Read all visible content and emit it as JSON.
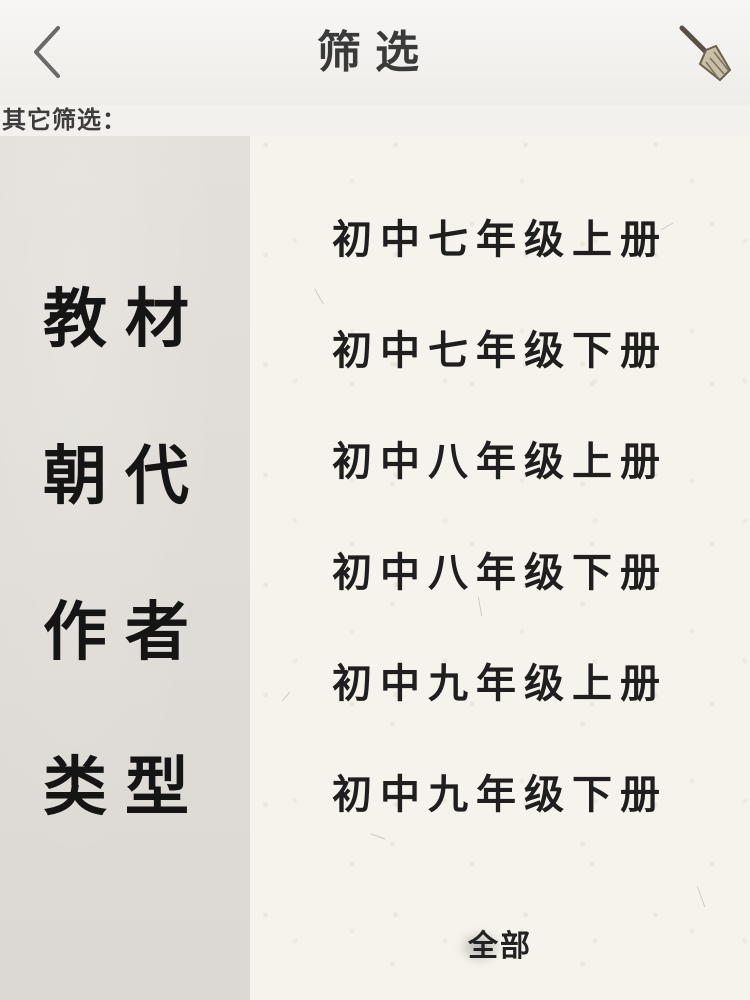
{
  "header": {
    "title": "筛选",
    "back_icon": "chevron-left-icon",
    "clear_icon": "broom-icon"
  },
  "filter_label": "其它筛选：",
  "categories": [
    {
      "label": "教材",
      "selected": true
    },
    {
      "label": "朝代",
      "selected": false
    },
    {
      "label": "作者",
      "selected": false
    },
    {
      "label": "类型",
      "selected": false
    }
  ],
  "options": [
    "初中七年级上册",
    "初中七年级下册",
    "初中八年级上册",
    "初中八年级下册",
    "初中九年级上册",
    "初中九年级下册"
  ],
  "all_label": "全部",
  "colors": {
    "text": "#1c1c1c",
    "left_panel": "#dfdbd6",
    "paper": "#f6f3ec"
  }
}
